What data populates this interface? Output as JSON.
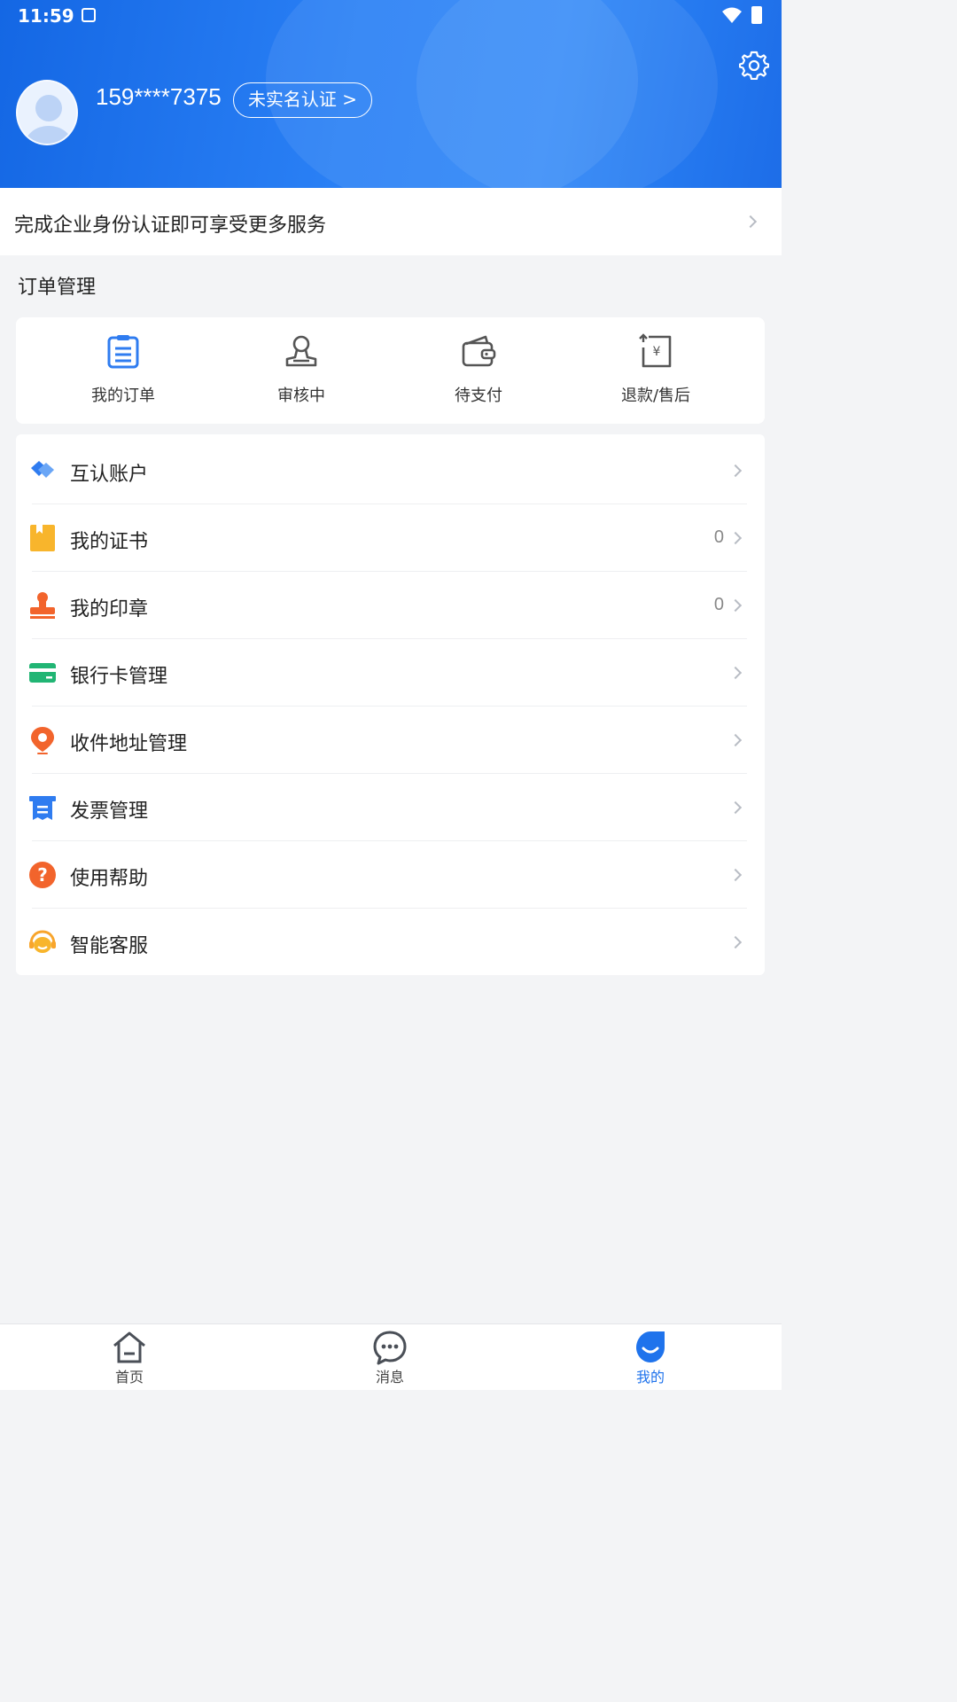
{
  "status_bar": {
    "time": "11:59"
  },
  "profile": {
    "phone": "159****7375",
    "verify_label": "未实名认证 >"
  },
  "enterprise_banner": {
    "text": "完成企业身份认证即可享受更多服务"
  },
  "orders": {
    "title": "订单管理",
    "items": [
      {
        "label": "我的订单",
        "icon": "order-list-icon"
      },
      {
        "label": "审核中",
        "icon": "reviewing-icon"
      },
      {
        "label": "待支付",
        "icon": "wallet-icon"
      },
      {
        "label": "退款/售后",
        "icon": "refund-icon"
      }
    ]
  },
  "menu": {
    "items": [
      {
        "label": "互认账户",
        "icon": "mutual-account-icon",
        "color": "#2f7cf0",
        "count": ""
      },
      {
        "label": "我的证书",
        "icon": "certificate-icon",
        "color": "#f8b52c",
        "count": "0"
      },
      {
        "label": "我的印章",
        "icon": "seal-icon",
        "color": "#f2642c",
        "count": "0"
      },
      {
        "label": "银行卡管理",
        "icon": "bank-card-icon",
        "color": "#21b574",
        "count": ""
      },
      {
        "label": "收件地址管理",
        "icon": "location-pin-icon",
        "color": "#f2642c",
        "count": ""
      },
      {
        "label": "发票管理",
        "icon": "invoice-icon",
        "color": "#2f7cf0",
        "count": ""
      },
      {
        "label": "使用帮助",
        "icon": "help-icon",
        "color": "#f2642c",
        "count": ""
      },
      {
        "label": "智能客服",
        "icon": "customer-service-icon",
        "color": "#f8a52c",
        "count": ""
      }
    ]
  },
  "tabbar": {
    "items": [
      {
        "label": "首页",
        "icon": "home-icon"
      },
      {
        "label": "消息",
        "icon": "message-icon"
      },
      {
        "label": "我的",
        "icon": "profile-icon",
        "active": true
      }
    ]
  },
  "colors": {
    "brand_blue": "#1f73ec",
    "background": "#f3f4f6"
  }
}
